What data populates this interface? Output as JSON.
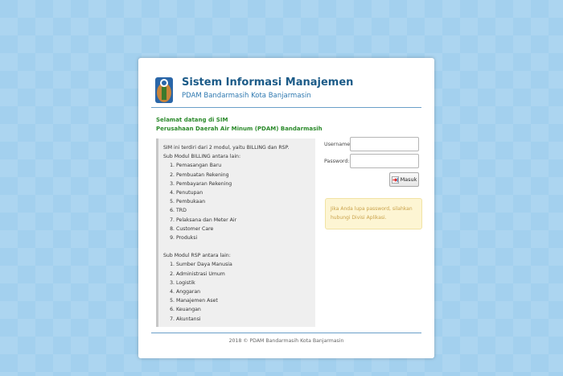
{
  "header": {
    "title": "Sistem Informasi Manajemen",
    "subtitle": "PDAM Bandarmasih Kota Banjarmasin",
    "logo_icon": "pdam-logo-icon"
  },
  "welcome": {
    "line1": "Selamat datang di SIM",
    "line2": "Perusahaan Daerah Air Minum (PDAM) Bandarmasih"
  },
  "info": {
    "intro": "SIM ini terdiri dari 2 modul, yaitu BILLING dan RSP.",
    "billing_heading": "Sub Modul BILLING antara lain:",
    "billing_items": [
      "Pemasangan Baru",
      "Pembuatan Rekening",
      "Pembayaran Rekening",
      "Penutupan",
      "Pembukaan",
      "TRD",
      "Pelaksana dan Meter Air",
      "Customer Care",
      "Produksi"
    ],
    "rsp_heading": "Sub Modul RSP antara lain:",
    "rsp_items": [
      "Sumber Daya Manusia",
      "Administrasi Umum",
      "Logistik",
      "Anggaran",
      "Manajemen Aset",
      "Keuangan",
      "Akuntansi"
    ]
  },
  "login": {
    "username_label": "Username:",
    "username_value": "",
    "password_label": "Password:",
    "password_value": "",
    "submit_label": "Masuk",
    "submit_icon": "login-arrow-icon"
  },
  "notice": {
    "line1": "Jika Anda lupa password, silahkan",
    "line2": "hubungi Divisi Aplikasi."
  },
  "footer": {
    "copyright": "2018 © PDAM Bandarmasih Kota Banjarmasin"
  },
  "colors": {
    "background": "#a3d0ee",
    "title": "#1c5b88",
    "welcome": "#2b8a2b",
    "notice_bg": "#fdf5d3",
    "notice_text": "#c9a24a"
  }
}
